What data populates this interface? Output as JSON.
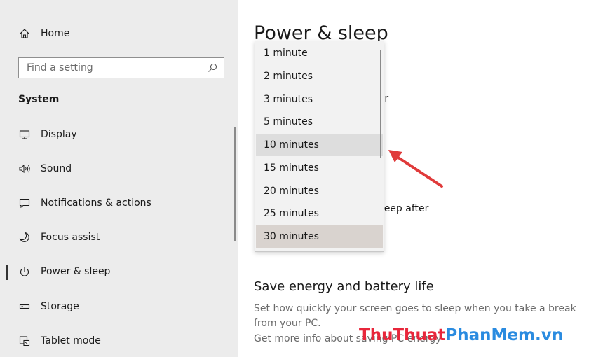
{
  "sidebar": {
    "home_label": "Home",
    "search_placeholder": "Find a setting",
    "section_header": "System",
    "items": [
      {
        "label": "Display",
        "icon": "monitor-icon"
      },
      {
        "label": "Sound",
        "icon": "speaker-icon"
      },
      {
        "label": "Notifications & actions",
        "icon": "notification-icon"
      },
      {
        "label": "Focus assist",
        "icon": "moon-icon"
      },
      {
        "label": "Power & sleep",
        "icon": "power-icon",
        "selected": true
      },
      {
        "label": "Storage",
        "icon": "storage-icon"
      },
      {
        "label": "Tablet mode",
        "icon": "tablet-mode-icon"
      }
    ]
  },
  "main": {
    "page_title": "Power & sleep",
    "screen_after_fragment": "after",
    "sleep_after_fragment": "to sleep after",
    "section_heading": "Save energy and battery life",
    "section_desc": "Set how quickly your screen goes to sleep when you take a break from your PC.",
    "link_text": "Get more info about saving PC energy"
  },
  "dropdown": {
    "options": [
      "1 minute",
      "2 minutes",
      "3 minutes",
      "5 minutes",
      "10 minutes",
      "15 minutes",
      "20 minutes",
      "25 minutes",
      "30 minutes"
    ],
    "highlighted": "10 minutes",
    "selected": "30 minutes"
  },
  "watermark": {
    "part1": "ThuThuat",
    "part2": "PhanMem.vn"
  },
  "colors": {
    "arrow": "#e03a3a",
    "watermark_red": "#e8263b",
    "watermark_blue": "#2a8be0"
  }
}
